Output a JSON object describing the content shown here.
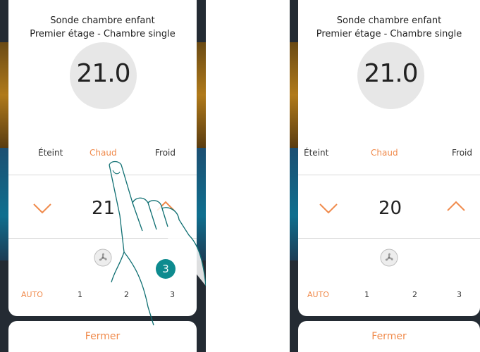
{
  "panels": [
    {
      "room_title": "Sonde chambre enfant",
      "room_subtitle": "Premier étage - Chambre single",
      "current_temp": "21.0",
      "modes": [
        "Éteint",
        "Chaud",
        "Froid"
      ],
      "active_mode": "Chaud",
      "setpoint": "21",
      "fan_speeds": [
        "AUTO",
        "1",
        "2",
        "3"
      ],
      "active_speed": "AUTO",
      "close_label": "Fermer",
      "step_badge": "3"
    },
    {
      "room_title": "Sonde chambre enfant",
      "room_subtitle": "Premier étage - Chambre single",
      "current_temp": "21.0",
      "modes": [
        "Éteint",
        "Chaud",
        "Froid"
      ],
      "active_mode": "Chaud",
      "setpoint": "20",
      "fan_speeds": [
        "AUTO",
        "1",
        "2",
        "3"
      ],
      "active_speed": "AUTO",
      "close_label": "Fermer"
    }
  ],
  "colors": {
    "accent": "#f08a4b",
    "badge": "#0e8b8f",
    "circle": "#e7e7e7"
  },
  "icons": [
    "chevron-down-icon",
    "chevron-up-icon",
    "fan-icon",
    "hand-pointer-icon"
  ]
}
